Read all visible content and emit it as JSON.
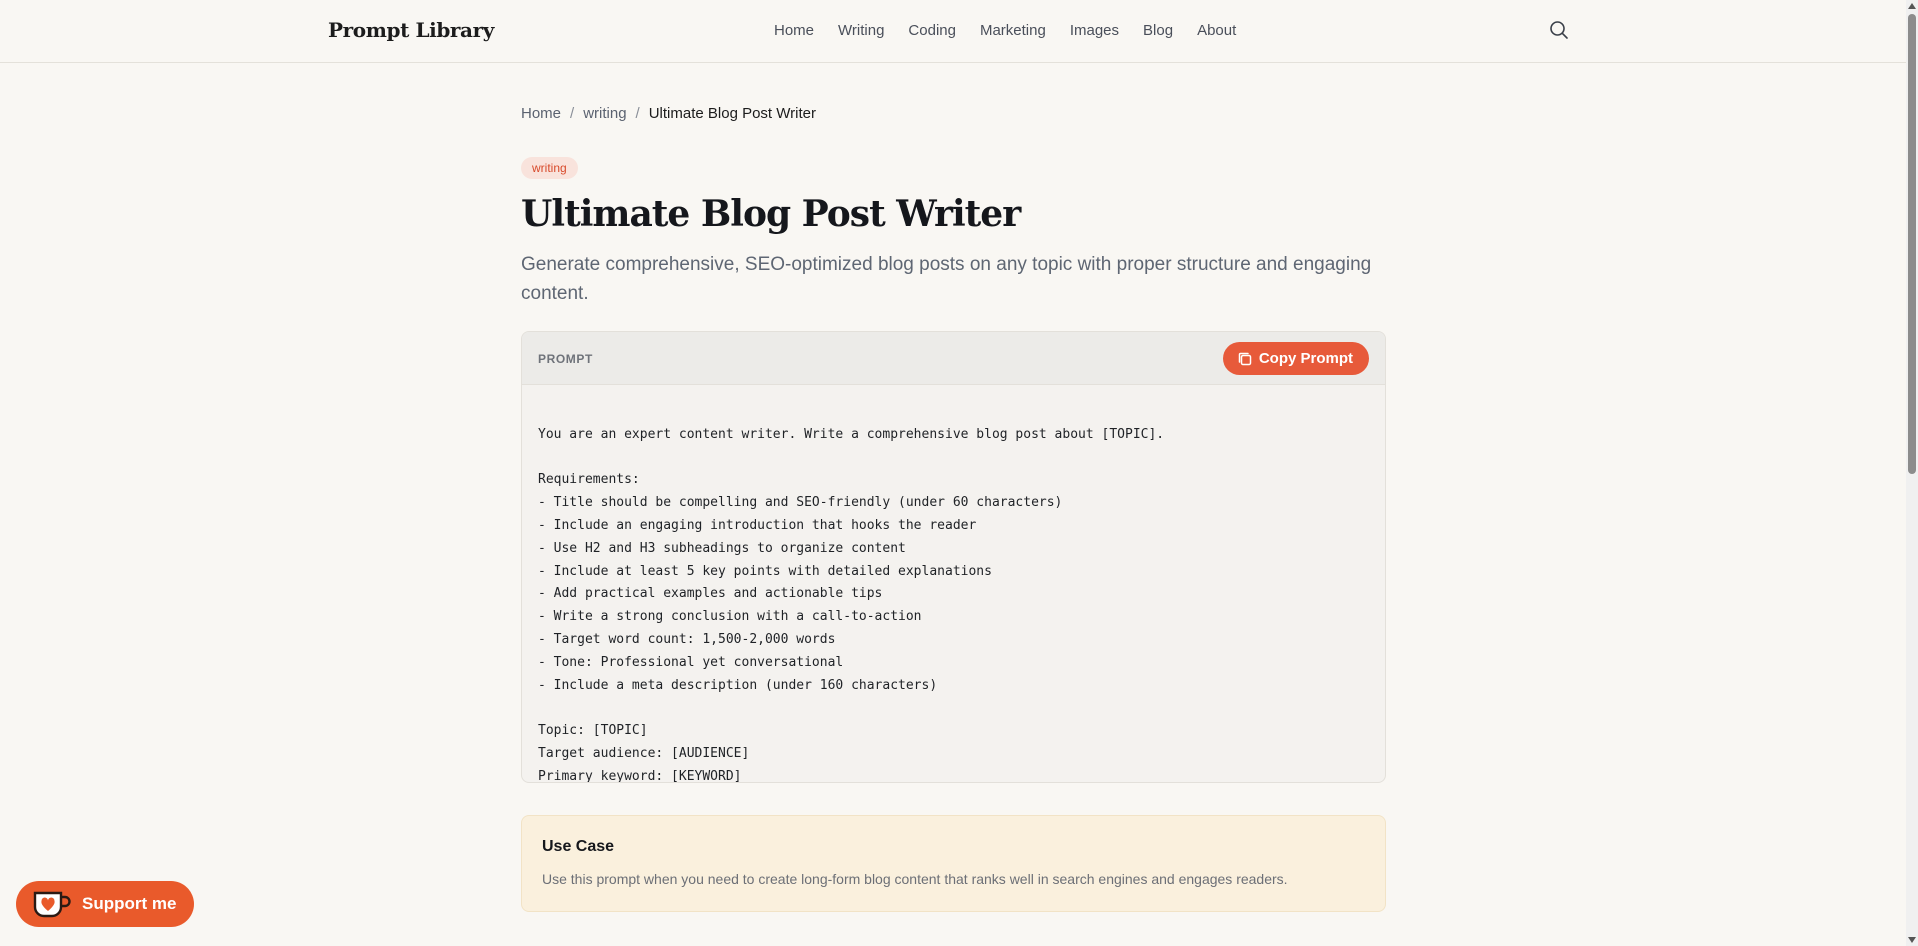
{
  "header": {
    "brand": "Prompt Library",
    "nav": [
      "Home",
      "Writing",
      "Coding",
      "Marketing",
      "Images",
      "Blog",
      "About"
    ],
    "search_icon": "search-icon"
  },
  "breadcrumb": {
    "home": "Home",
    "sep1": "/",
    "category": "writing",
    "sep2": "/",
    "current": "Ultimate Blog Post Writer"
  },
  "tag": "writing",
  "title": "Ultimate Blog Post Writer",
  "subtitle": "Generate comprehensive, SEO-optimized blog posts on any topic with proper structure and engaging content.",
  "prompt": {
    "label": "PROMPT",
    "copy_label": "Copy Prompt",
    "lines": [
      "You are an expert content writer. Write a comprehensive blog post about [TOPIC].",
      "",
      "Requirements:",
      "- Title should be compelling and SEO-friendly (under 60 characters)",
      "- Include an engaging introduction that hooks the reader",
      "- Use H2 and H3 subheadings to organize content",
      "- Include at least 5 key points with detailed explanations",
      "- Add practical examples and actionable tips",
      "- Write a strong conclusion with a call-to-action",
      "- Target word count: 1,500-2,000 words",
      "- Tone: Professional yet conversational",
      "- Include a meta description (under 160 characters)",
      "",
      "Topic: [TOPIC]",
      "Target audience: [AUDIENCE]",
      "Primary keyword: [KEYWORD]"
    ]
  },
  "use_case": {
    "heading": "Use Case",
    "text": "Use this prompt when you need to create long-form blog content that ranks well in search engines and engages readers."
  },
  "support": {
    "label": "Support me"
  },
  "colors": {
    "accent": "#e75a3a",
    "background": "#f9f7f3",
    "tag_bg": "#f9e3dc",
    "usecase_bg": "#faf0dd"
  }
}
